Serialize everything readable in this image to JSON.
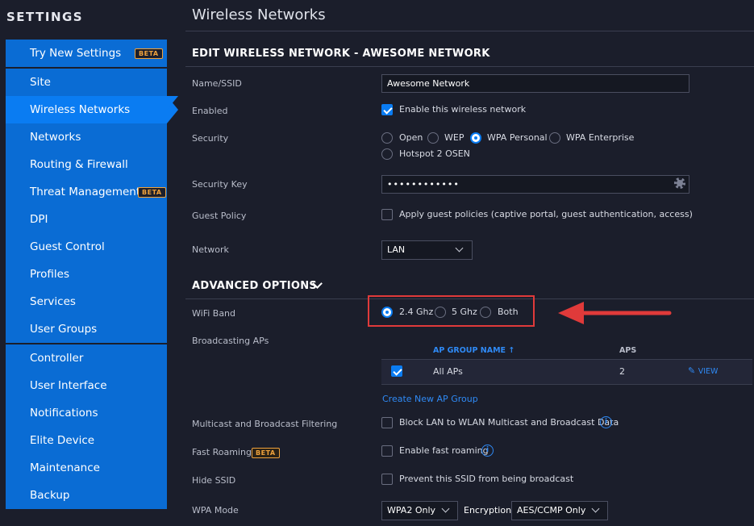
{
  "sidebar": {
    "title": "SETTINGS",
    "try_new": {
      "label": "Try New Settings",
      "badge": "BETA"
    },
    "group1": [
      {
        "label": "Site"
      },
      {
        "label": "Wireless Networks"
      },
      {
        "label": "Networks"
      },
      {
        "label": "Routing & Firewall"
      },
      {
        "label": "Threat Management",
        "badge": "BETA"
      },
      {
        "label": "DPI"
      },
      {
        "label": "Guest Control"
      },
      {
        "label": "Profiles"
      },
      {
        "label": "Services"
      },
      {
        "label": "User Groups"
      }
    ],
    "group2": [
      {
        "label": "Controller"
      },
      {
        "label": "User Interface"
      },
      {
        "label": "Notifications"
      },
      {
        "label": "Elite Device"
      },
      {
        "label": "Maintenance"
      },
      {
        "label": "Backup"
      }
    ]
  },
  "main": {
    "page_title": "Wireless Networks",
    "edit_title": "EDIT WIRELESS NETWORK - AWESOME NETWORK",
    "ssid": {
      "label": "Name/SSID",
      "value": "Awesome Network"
    },
    "enabled": {
      "label": "Enabled",
      "checkbox_label": "Enable this wireless network",
      "checked": true
    },
    "security": {
      "label": "Security",
      "options": [
        "Open",
        "WEP",
        "WPA Personal",
        "WPA Enterprise",
        "Hotspot 2 OSEN"
      ],
      "selected": "WPA Personal"
    },
    "security_key": {
      "label": "Security Key",
      "value": "••••••••••••"
    },
    "guest_policy": {
      "label": "Guest Policy",
      "checkbox_label": "Apply guest policies (captive portal, guest authentication, access)",
      "checked": false
    },
    "network": {
      "label": "Network",
      "value": "LAN"
    },
    "advanced_title": "ADVANCED OPTIONS",
    "wifi_band": {
      "label": "WiFi Band",
      "options": [
        "2.4 Ghz",
        "5 Ghz",
        "Both"
      ],
      "selected": "2.4 Ghz"
    },
    "broadcasting": {
      "label": "Broadcasting APs",
      "col_group": "AP GROUP NAME",
      "col_aps": "APS",
      "rows": [
        {
          "name": "All APs",
          "aps": "2",
          "action": "VIEW",
          "checked": true
        }
      ],
      "create_link": "Create New AP Group"
    },
    "multicast": {
      "label": "Multicast and Broadcast Filtering",
      "checkbox_label": "Block LAN to WLAN Multicast and Broadcast Data"
    },
    "fast_roaming": {
      "label": "Fast Roaming",
      "badge": "BETA",
      "checkbox_label": "Enable fast roaming"
    },
    "hide_ssid": {
      "label": "Hide SSID",
      "checkbox_label": "Prevent this SSID from being broadcast"
    },
    "wpa_mode": {
      "label": "WPA Mode",
      "value": "WPA2 Only",
      "encryption_label": "Encryption",
      "encryption_value": "AES/CCMP Only"
    }
  },
  "colors": {
    "accent": "#0a7cf2",
    "sidebar": "#0a6cd4",
    "background": "#1b1e2b",
    "highlight": "#e03a3a",
    "beta": "#f0a23c"
  }
}
